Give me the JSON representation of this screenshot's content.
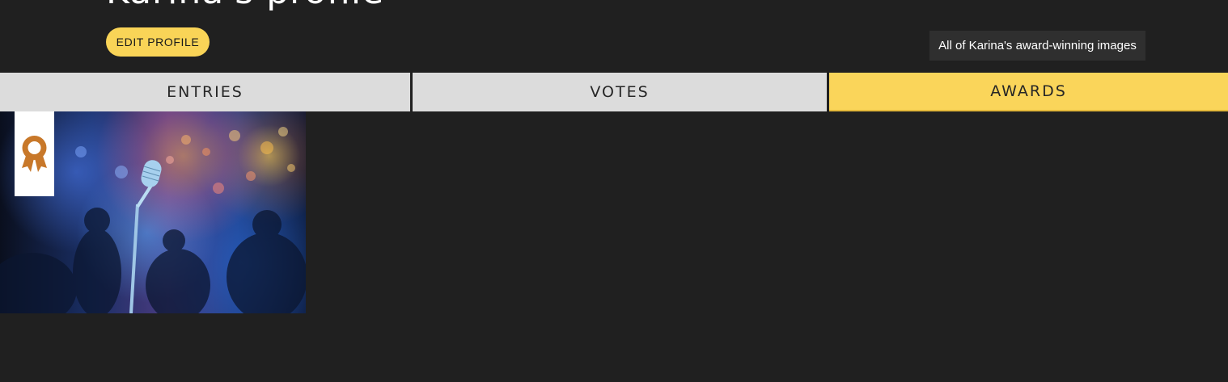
{
  "profile": {
    "title": "Karina's profile",
    "edit_button": "EDIT PROFILE"
  },
  "tooltip": {
    "text": "All of Karina's award-winning images"
  },
  "tabs": [
    {
      "label": "ENTRIES",
      "active": false
    },
    {
      "label": "VOTES",
      "active": false
    },
    {
      "label": "AWARDS",
      "active": true
    }
  ],
  "awards": {
    "items": [
      {
        "subject": "microphone",
        "badge_icon": "award-ribbon-icon"
      }
    ]
  },
  "colors": {
    "background": "#202020",
    "accent": "#fad55a",
    "tab_inactive": "#dcdcdc",
    "badge": "#c8782a"
  }
}
